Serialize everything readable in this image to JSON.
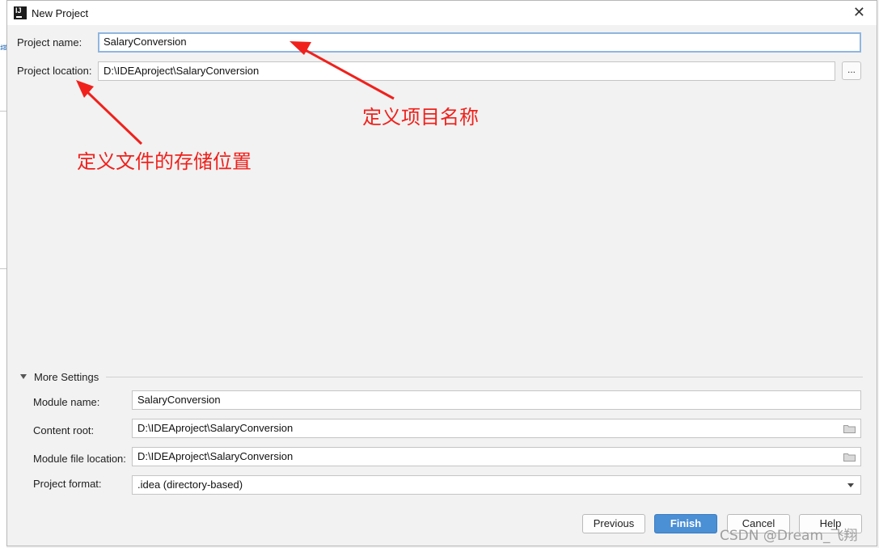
{
  "window": {
    "title": "New Project"
  },
  "project": {
    "name_label": "Project name:",
    "name_value": "SalaryConversion",
    "location_label": "Project location:",
    "location_value": "D:\\IDEAproject\\SalaryConversion",
    "browse_label": "..."
  },
  "more_settings": {
    "toggle_label": "More Settings",
    "module_name_label": "Module name:",
    "module_name_value": "SalaryConversion",
    "content_root_label": "Content root:",
    "content_root_value": "D:\\IDEAproject\\SalaryConversion",
    "module_file_label": "Module file location:",
    "module_file_value": "D:\\IDEAproject\\SalaryConversion",
    "format_label": "Project format:",
    "format_value": ".idea (directory-based)"
  },
  "buttons": {
    "previous": "Previous",
    "finish": "Finish",
    "cancel": "Cancel",
    "help": "Help"
  },
  "annotations": {
    "name_note": "定义项目名称",
    "location_note": "定义文件的存储位置"
  },
  "watermark": "CSDN @Dream_飞翔",
  "icons": {
    "app": "intellij-icon",
    "close": "close-icon",
    "folder": "folder-icon",
    "expand": "triangle-down-icon",
    "dropdown": "chevron-down-icon"
  },
  "colors": {
    "annotation": "#f0211c",
    "primary_button": "#4b8fd4",
    "focus_border": "#8fb6e0"
  }
}
